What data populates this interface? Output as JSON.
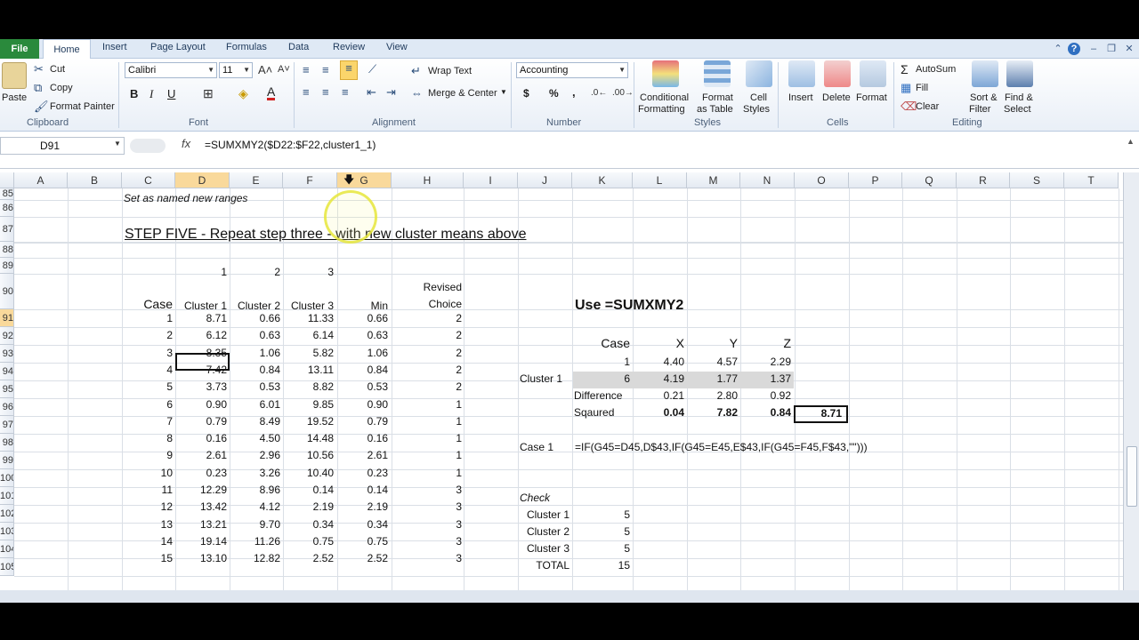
{
  "tabs": [
    "File",
    "Home",
    "Insert",
    "Page Layout",
    "Formulas",
    "Data",
    "Review",
    "View"
  ],
  "ribbon": {
    "clipboard": {
      "paste": "Paste",
      "cut": "Cut",
      "copy": "Copy",
      "format_painter": "Format Painter",
      "label": "Clipboard"
    },
    "font": {
      "name": "Calibri",
      "size": "11",
      "label": "Font",
      "bold": "B",
      "italic": "I",
      "underline": "U"
    },
    "alignment": {
      "wrap_text": "Wrap Text",
      "merge_center": "Merge & Center",
      "label": "Alignment"
    },
    "number": {
      "format": "Accounting",
      "currency": "$",
      "percent": "%",
      "comma": ",",
      "label": "Number"
    },
    "styles": {
      "conditional": "Conditional",
      "conditional2": "Formatting",
      "format_as": "Format",
      "format_as2": "as Table",
      "cell": "Cell",
      "cell2": "Styles",
      "label": "Styles"
    },
    "cells": {
      "insert": "Insert",
      "delete": "Delete",
      "format": "Format",
      "label": "Cells"
    },
    "editing": {
      "autosum": "AutoSum",
      "fill": "Fill",
      "clear": "Clear",
      "sort": "Sort &",
      "sort2": "Filter",
      "find": "Find &",
      "find2": "Select",
      "label": "Editing"
    }
  },
  "formula_bar": {
    "name_box": "D91",
    "fx": "fx",
    "formula": "=SUMXMY2($D22:$F22,cluster1_1)"
  },
  "columns": [
    "A",
    "B",
    "C",
    "D",
    "E",
    "F",
    "G",
    "H",
    "I",
    "J",
    "K",
    "L",
    "M",
    "N",
    "O",
    "P",
    "Q",
    "R",
    "S",
    "T"
  ],
  "rows": [
    "85",
    "86",
    "87",
    "88",
    "89",
    "90",
    "91",
    "92",
    "93",
    "94",
    "95",
    "96",
    "97",
    "98",
    "99",
    "100",
    "101",
    "102",
    "103",
    "104",
    "105"
  ],
  "sheet": {
    "note": "Set as named new ranges",
    "step_title": "STEP FIVE - Repeat step three - with new cluster means above",
    "idx1": "1",
    "idx2": "2",
    "idx3": "3",
    "h_case": "Case",
    "h_c1": "Cluster 1",
    "h_c2": "Cluster 2",
    "h_c3": "Cluster 3",
    "h_min": "Min",
    "h_revised": "Revised",
    "h_choice": "Choice",
    "table": [
      [
        "1",
        "8.71",
        "0.66",
        "11.33",
        "0.66",
        "2"
      ],
      [
        "2",
        "6.12",
        "0.63",
        "6.14",
        "0.63",
        "2"
      ],
      [
        "3",
        "8.35",
        "1.06",
        "5.82",
        "1.06",
        "2"
      ],
      [
        "4",
        "7.42",
        "0.84",
        "13.11",
        "0.84",
        "2"
      ],
      [
        "5",
        "3.73",
        "0.53",
        "8.82",
        "0.53",
        "2"
      ],
      [
        "6",
        "0.90",
        "6.01",
        "9.85",
        "0.90",
        "1"
      ],
      [
        "7",
        "0.79",
        "8.49",
        "19.52",
        "0.79",
        "1"
      ],
      [
        "8",
        "0.16",
        "4.50",
        "14.48",
        "0.16",
        "1"
      ],
      [
        "9",
        "2.61",
        "2.96",
        "10.56",
        "2.61",
        "1"
      ],
      [
        "10",
        "0.23",
        "3.26",
        "10.40",
        "0.23",
        "1"
      ],
      [
        "11",
        "12.29",
        "8.96",
        "0.14",
        "0.14",
        "3"
      ],
      [
        "12",
        "13.42",
        "4.12",
        "2.19",
        "2.19",
        "3"
      ],
      [
        "13",
        "13.21",
        "9.70",
        "0.34",
        "0.34",
        "3"
      ],
      [
        "14",
        "19.14",
        "11.26",
        "0.75",
        "0.75",
        "3"
      ],
      [
        "15",
        "13.10",
        "12.82",
        "2.52",
        "2.52",
        "3"
      ]
    ],
    "use_label": "Use =SUMXMY2",
    "r_case": "Case",
    "r_x": "X",
    "r_y": "Y",
    "r_z": "Z",
    "r_row1": [
      "1",
      "4.40",
      "4.57",
      "2.29"
    ],
    "r_cluster1": "Cluster 1",
    "r_row2": [
      "6",
      "4.19",
      "1.77",
      "1.37"
    ],
    "r_diff": "Difference",
    "r_row3": [
      "0.21",
      "2.80",
      "0.92"
    ],
    "r_sq": "Sqaured",
    "r_row4": [
      "0.04",
      "7.82",
      "0.84"
    ],
    "r_result": "8.71",
    "case1_label": "Case 1",
    "case1_formula": "=IF(G45=D45,D$43,IF(G45=E45,E$43,IF(G45=F45,F$43,\"\")))",
    "check": "Check",
    "check_rows": [
      [
        "Cluster 1",
        "5"
      ],
      [
        "Cluster 2",
        "5"
      ],
      [
        "Cluster 3",
        "5"
      ],
      [
        "TOTAL",
        "15"
      ]
    ]
  }
}
